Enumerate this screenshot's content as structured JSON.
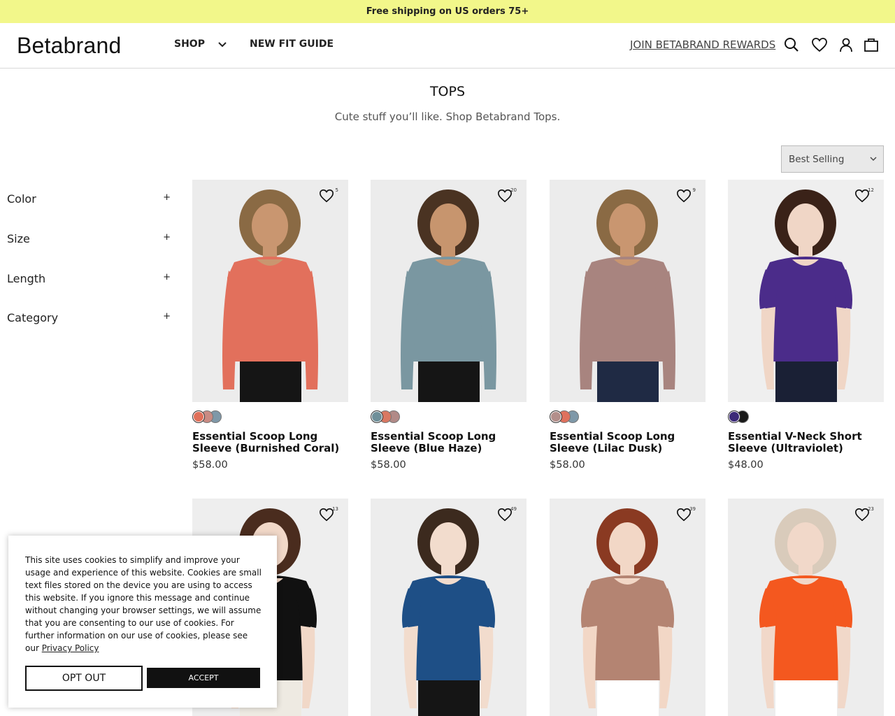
{
  "promo": {
    "text": "Free shipping on US orders 75+"
  },
  "header": {
    "logo": "Betabrand",
    "nav": {
      "shop": "SHOP",
      "fit_guide": "NEW FIT GUIDE"
    },
    "rewards": "JOIN BETABRAND REWARDS",
    "icons": [
      "search-icon",
      "heart-icon",
      "account-icon",
      "bag-icon"
    ]
  },
  "page": {
    "title": "TOPS",
    "subtitle": "Cute stuff you’ll like. Shop Betabrand Tops.",
    "sort": {
      "selected": "Best Selling"
    }
  },
  "filters": [
    "Color",
    "Size",
    "Length",
    "Category"
  ],
  "filter_toggle": "+",
  "products": [
    {
      "name": "Essential Scoop Long Sleeve (Burnished Coral)",
      "price": "$58.00",
      "wish_count": "5",
      "top_color": "#e2705c",
      "bg": "#ececec",
      "skin": "#c99670",
      "hair": "#8a6a44",
      "sleeve": "long",
      "pants": "#151515",
      "swatches": [
        "#e0705a",
        "#c98b83",
        "#7f98a8"
      ]
    },
    {
      "name": "Essential Scoop Long Sleeve (Blue Haze)",
      "price": "$58.00",
      "wish_count": "20",
      "top_color": "#7a97a1",
      "bg": "#ececec",
      "skin": "#c7956e",
      "hair": "#4a3322",
      "sleeve": "long",
      "pants": "#151515",
      "swatches": [
        "#6f8f99",
        "#d97862",
        "#b18a87"
      ]
    },
    {
      "name": "Essential Scoop Long Sleeve (Lilac Dusk)",
      "price": "$58.00",
      "wish_count": "9",
      "top_color": "#a8847f",
      "bg": "#ececec",
      "skin": "#c99670",
      "hair": "#8a6a44",
      "sleeve": "long",
      "pants": "#1f2a44",
      "swatches": [
        "#b38f8b",
        "#df715d",
        "#7f98a8"
      ]
    },
    {
      "name": "Essential V-Neck Short Sleeve (Ultraviolet)",
      "price": "$48.00",
      "wish_count": "12",
      "top_color": "#4b2c8a",
      "bg": "#efefef",
      "skin": "#f0d6c6",
      "hair": "#3a2218",
      "sleeve": "short",
      "pants": "#1a2035",
      "swatches": [
        "#3c2a78",
        "#1a1a1a"
      ]
    },
    {
      "name": "",
      "price": "",
      "wish_count": "13",
      "top_color": "#111111",
      "bg": "#eeeeee",
      "skin": "#f1d8c8",
      "hair": "#4a2c1e",
      "sleeve": "short",
      "pants": "#eeeae2",
      "swatches": []
    },
    {
      "name": "",
      "price": "",
      "wish_count": "49",
      "top_color": "#1e4f86",
      "bg": "#ededed",
      "skin": "#f2dccd",
      "hair": "#3c2a1e",
      "sleeve": "short",
      "pants": "#151515",
      "swatches": []
    },
    {
      "name": "",
      "price": "",
      "wish_count": "39",
      "top_color": "#b48472",
      "bg": "#ededed",
      "skin": "#f2d7c6",
      "hair": "#8a3a22",
      "sleeve": "short",
      "pants": "#ffffff",
      "swatches": []
    },
    {
      "name": "",
      "price": "",
      "wish_count": "23",
      "top_color": "#f4581f",
      "bg": "#ededed",
      "skin": "#f1d8c9",
      "hair": "#d9cbbb",
      "sleeve": "short",
      "pants": "#ffffff",
      "swatches": []
    }
  ],
  "cookie": {
    "text": "This site uses cookies to simplify and improve your usage and experience of this website. Cookies are small text files stored on the device you are using to access this website. If you ignore this message and continue without changing your browser settings, we will assume that you are consenting to our use of cookies. For further information on our use of cookies, please see our",
    "link": "Privacy Policy",
    "opt_out": "OPT OUT",
    "accept": "ACCEPT"
  }
}
